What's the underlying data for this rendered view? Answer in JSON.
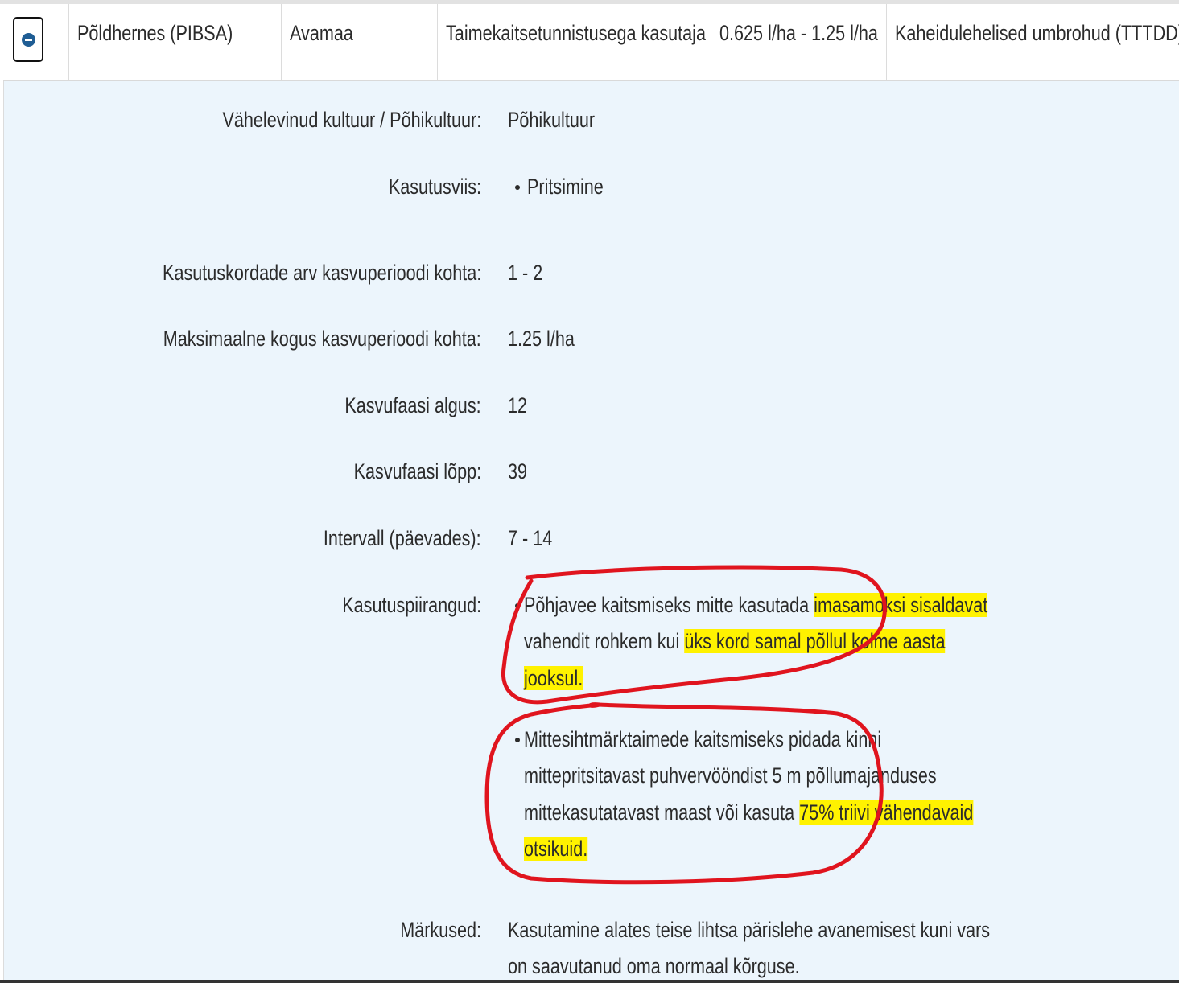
{
  "row": {
    "collapse_icon": "minus-circle-icon",
    "crop": "Põldhernes (PIBSA)",
    "area": "Avamaa",
    "user": "Taimekaitsetunnistusega kasutaja",
    "dose": "0.625 l/ha - 1.25 l/ha",
    "target": "Kaheidulehelised umbrohud (TTTDD)"
  },
  "details": {
    "intercrop_label": "Vähelevinud kultuur / Põhikultuur:",
    "intercrop_value": "Põhikultuur",
    "method_label": "Kasutusviis:",
    "method_value": "Pritsimine",
    "count_label": "Kasutuskordade arv kasvuperioodi kohta:",
    "count_value": "1 - 2",
    "max_label": "Maksimaalne kogus kasvuperioodi kohta:",
    "max_value": "1.25 l/ha",
    "phase_start_label": "Kasvufaasi algus:",
    "phase_start_value": "12",
    "phase_end_label": "Kasvufaasi lõpp:",
    "phase_end_value": "39",
    "interval_label": "Intervall (päevades):",
    "interval_value": "7 - 14",
    "restrictions_label": "Kasutuspiirangud:",
    "restriction1": {
      "l1a": "Põhjavee kaitsmiseks mitte kasutada ",
      "l1b": "imasamoksi sisaldavat",
      "l2a": "vahendit rohkem kui ",
      "l2b": "üks kord samal põllul kolme aasta",
      "l3": "jooksul."
    },
    "restriction2": {
      "l1": "Mittesihtmärktaimede kaitsmiseks pidada kinni",
      "l2": "mittepritsitavast puhvervööndist 5 m põllumajanduses",
      "l3a": "mittekasutatavast maast või kasuta ",
      "l3b": "75% triivi vähendavaid",
      "l4": "otsikuid."
    },
    "notes_label": "Märkused:",
    "notes_l1": "Kasutamine alates teise lihtsa pärislehe avanemisest kuni vars",
    "notes_l2": "on saavutanud oma normaal kõrguse."
  },
  "colors": {
    "detail_background": "#ecf5fc",
    "highlight": "#fff200",
    "annotation": "#e0141e",
    "icon_blue": "#1f5d94"
  }
}
